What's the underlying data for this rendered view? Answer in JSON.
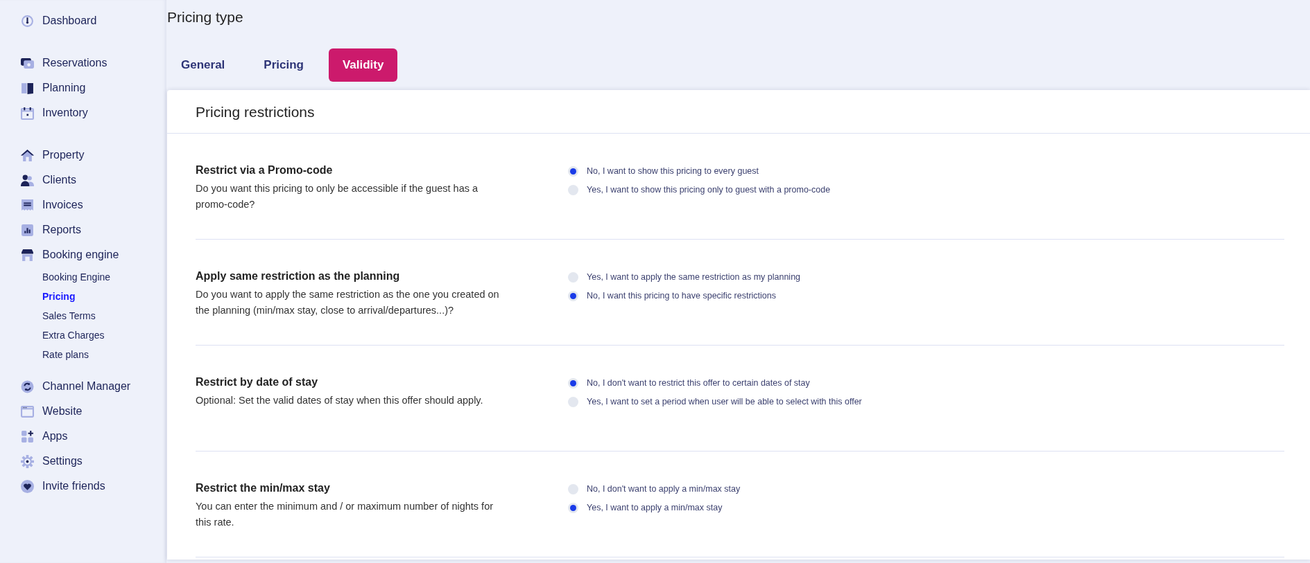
{
  "sidebar": {
    "groups": [
      {
        "items": [
          {
            "label": "Dashboard",
            "selected": false
          }
        ]
      },
      {
        "items": [
          {
            "label": "Reservations",
            "selected": false
          },
          {
            "label": "Planning",
            "selected": false
          },
          {
            "label": "Inventory",
            "selected": false
          }
        ]
      },
      {
        "items": [
          {
            "label": "Property",
            "selected": false
          },
          {
            "label": "Clients",
            "selected": false
          },
          {
            "label": "Invoices",
            "selected": false
          },
          {
            "label": "Reports",
            "selected": false
          },
          {
            "label": "Booking engine",
            "selected": false,
            "expanded": true,
            "children": [
              {
                "label": "Booking Engine",
                "selected": false
              },
              {
                "label": "Pricing",
                "selected": true
              },
              {
                "label": "Sales Terms",
                "selected": false
              },
              {
                "label": "Extra Charges",
                "selected": false
              },
              {
                "label": "Rate plans",
                "selected": false
              }
            ]
          }
        ]
      },
      {
        "items": [
          {
            "label": "Channel Manager",
            "selected": false
          },
          {
            "label": "Website",
            "selected": false
          },
          {
            "label": "Apps",
            "selected": false
          },
          {
            "label": "Settings",
            "selected": false
          },
          {
            "label": "Invite friends",
            "selected": false
          }
        ]
      }
    ]
  },
  "page_title": "Pricing type",
  "tabs": [
    {
      "label": "General",
      "selected": false
    },
    {
      "label": "Pricing",
      "selected": false
    },
    {
      "label": "Validity",
      "selected": true
    }
  ],
  "card": {
    "title": "Pricing restrictions",
    "sections": [
      {
        "title": "Restrict via a Promo-code",
        "description": "Do you want this pricing to only be accessible if the guest has a promo-code?",
        "options": [
          {
            "label": "No, I want to show this pricing to every guest",
            "selected": true
          },
          {
            "label": "Yes, I want to show this pricing only to guest with a promo-code",
            "selected": false
          }
        ]
      },
      {
        "title": "Apply same restriction as the planning",
        "description": "Do you want to apply the same restriction as the one you created on the planning (min/max stay, close to arrival/departures...)?",
        "options": [
          {
            "label": "Yes, I want to apply the same restriction as my planning",
            "selected": false
          },
          {
            "label": "No, I want this pricing to have specific restrictions",
            "selected": true
          }
        ]
      },
      {
        "title": "Restrict by date of stay",
        "description": "Optional: Set the valid dates of stay when this offer should apply.",
        "options": [
          {
            "label": "No, I don't want to restrict this offer to certain dates of stay",
            "selected": true
          },
          {
            "label": "Yes, I want to set a period when user will be able to select with this offer",
            "selected": false
          }
        ]
      },
      {
        "title": "Restrict the min/max stay",
        "description": "You can enter the minimum and / or maximum number of nights for this rate.",
        "options": [
          {
            "label": "No, I don't want to apply a min/max stay",
            "selected": false
          },
          {
            "label": "Yes, I want to apply a min/max stay",
            "selected": true
          }
        ]
      }
    ]
  }
}
